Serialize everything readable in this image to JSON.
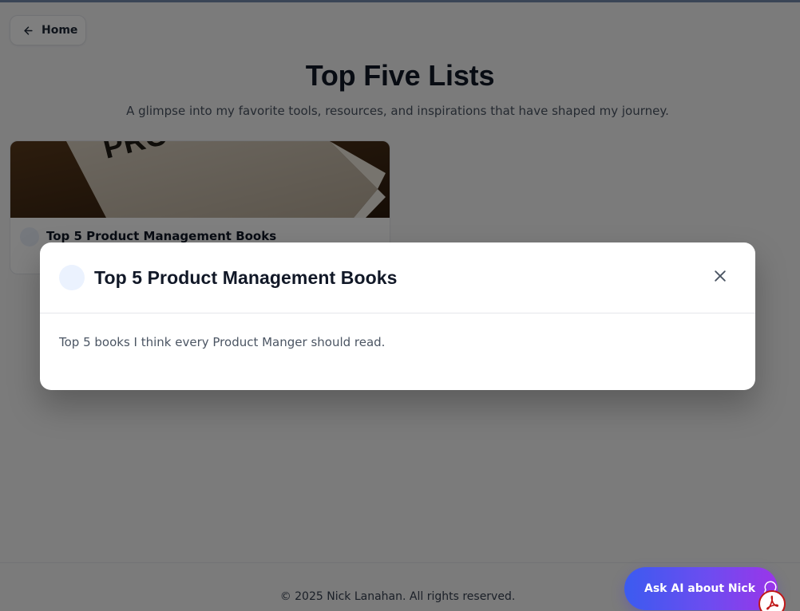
{
  "nav": {
    "home_label": "Home"
  },
  "header": {
    "title": "Top Five Lists",
    "subtitle": "A glimpse into my favorite tools, resources, and inspirations that have shaped my journey."
  },
  "cards": [
    {
      "title": "Top 5 Product Management Books"
    }
  ],
  "modal": {
    "title": "Top 5 Product Management Books",
    "description": "Top 5 books I think every Product Manger should read."
  },
  "footer": {
    "text": "© 2025 Nick Lanahan. All rights reserved."
  },
  "ask_ai": {
    "label": "Ask AI about Nick"
  },
  "colors": {
    "accent_gradient_start": "#3b5bf0",
    "accent_gradient_end": "#9b35e9",
    "pdf_red": "#c01818"
  },
  "icons": {
    "home": "arrow-left-icon",
    "close": "close-icon",
    "chat": "chat-bubble-icon",
    "pdf": "pdf-icon"
  }
}
